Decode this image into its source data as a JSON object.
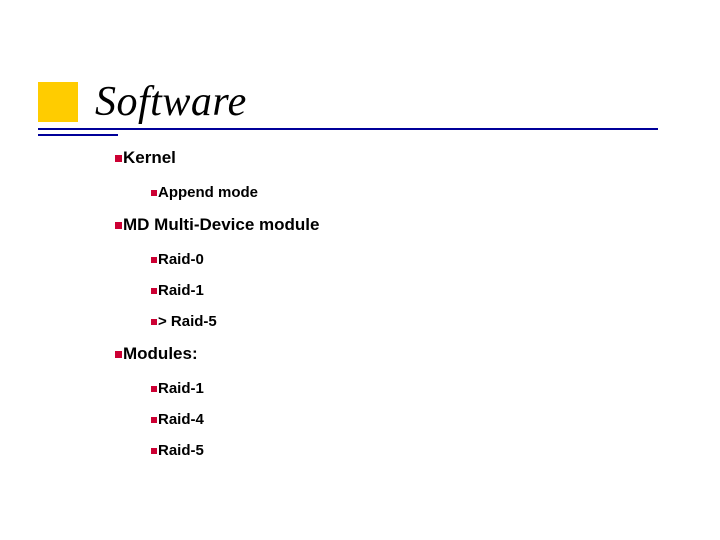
{
  "title": "Software",
  "items": {
    "l1_0": "Kernel",
    "l2_0": "Append mode",
    "l1_1": "MD Multi-Device module",
    "l2_1": "Raid-0",
    "l2_2": "Raid-1",
    "l2_3": "> Raid-5",
    "l1_2": "Modules:",
    "l2_4": "Raid-1",
    "l2_5": "Raid-4",
    "l2_6": "Raid-5"
  }
}
